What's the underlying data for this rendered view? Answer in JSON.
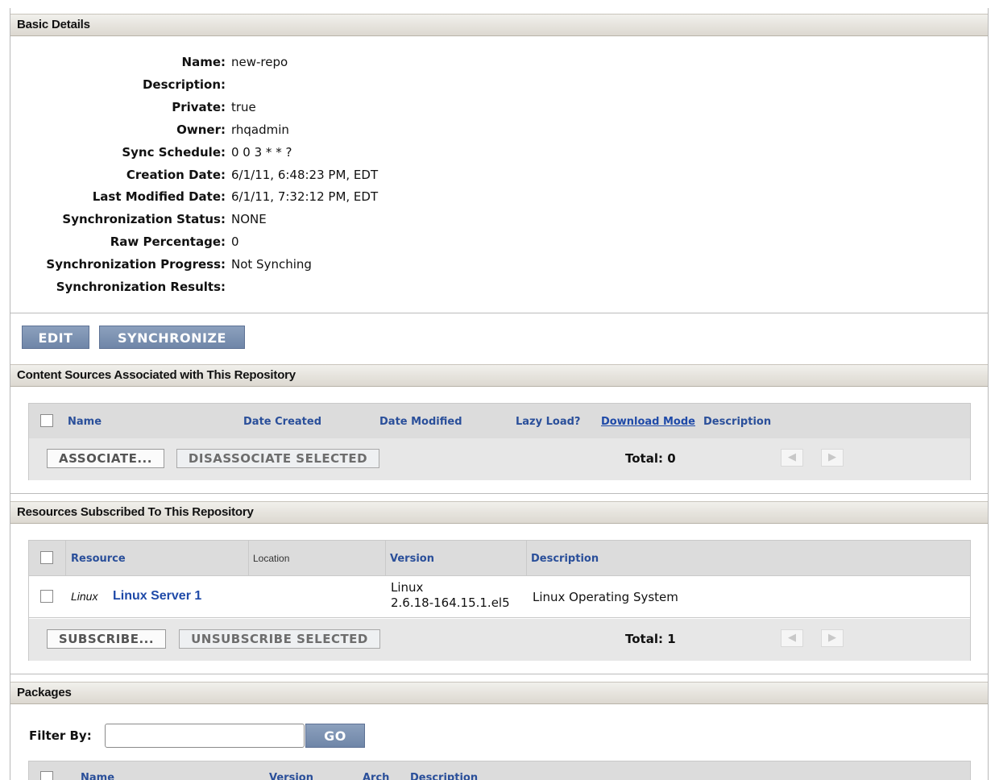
{
  "basic_details": {
    "title": "Basic Details",
    "rows": [
      {
        "label": "Name:",
        "value": "new-repo"
      },
      {
        "label": "Description:",
        "value": ""
      },
      {
        "label": "Private:",
        "value": "true"
      },
      {
        "label": "Owner:",
        "value": "rhqadmin"
      },
      {
        "label": "Sync Schedule:",
        "value": "0 0 3 * * ?"
      },
      {
        "label": "Creation Date:",
        "value": "6/1/11, 6:48:23 PM, EDT"
      },
      {
        "label": "Last Modified Date:",
        "value": "6/1/11, 7:32:12 PM, EDT"
      },
      {
        "label": "Synchronization Status:",
        "value": "NONE"
      },
      {
        "label": "Raw Percentage:",
        "value": "0"
      },
      {
        "label": "Synchronization Progress:",
        "value": "Not Synching"
      },
      {
        "label": "Synchronization Results:",
        "value": ""
      }
    ],
    "edit_label": "EDIT",
    "synchronize_label": "SYNCHRONIZE"
  },
  "content_sources": {
    "title": "Content Sources Associated with This Repository",
    "columns": [
      "Name",
      "Date Created",
      "Date Modified",
      "Lazy Load?",
      "Download Mode",
      "Description"
    ],
    "associate_label": "ASSOCIATE...",
    "disassociate_label": "DISASSOCIATE SELECTED",
    "total": "Total: 0"
  },
  "resources": {
    "title": "Resources Subscribed To This Repository",
    "columns": [
      "Resource",
      "Location",
      "Version",
      "Description"
    ],
    "rows": [
      {
        "type": "Linux",
        "name": "Linux Server 1",
        "location": "",
        "version_line1": "Linux",
        "version_line2": "2.6.18-164.15.1.el5",
        "description": "Linux Operating System"
      }
    ],
    "subscribe_label": "SUBSCRIBE...",
    "unsubscribe_label": "UNSUBSCRIBE SELECTED",
    "total": "Total: 1"
  },
  "packages": {
    "title": "Packages",
    "filter_label": "Filter By:",
    "filter_value": "",
    "go_label": "GO",
    "columns": [
      "Name",
      "Version",
      "Arch",
      "Description"
    ]
  }
}
